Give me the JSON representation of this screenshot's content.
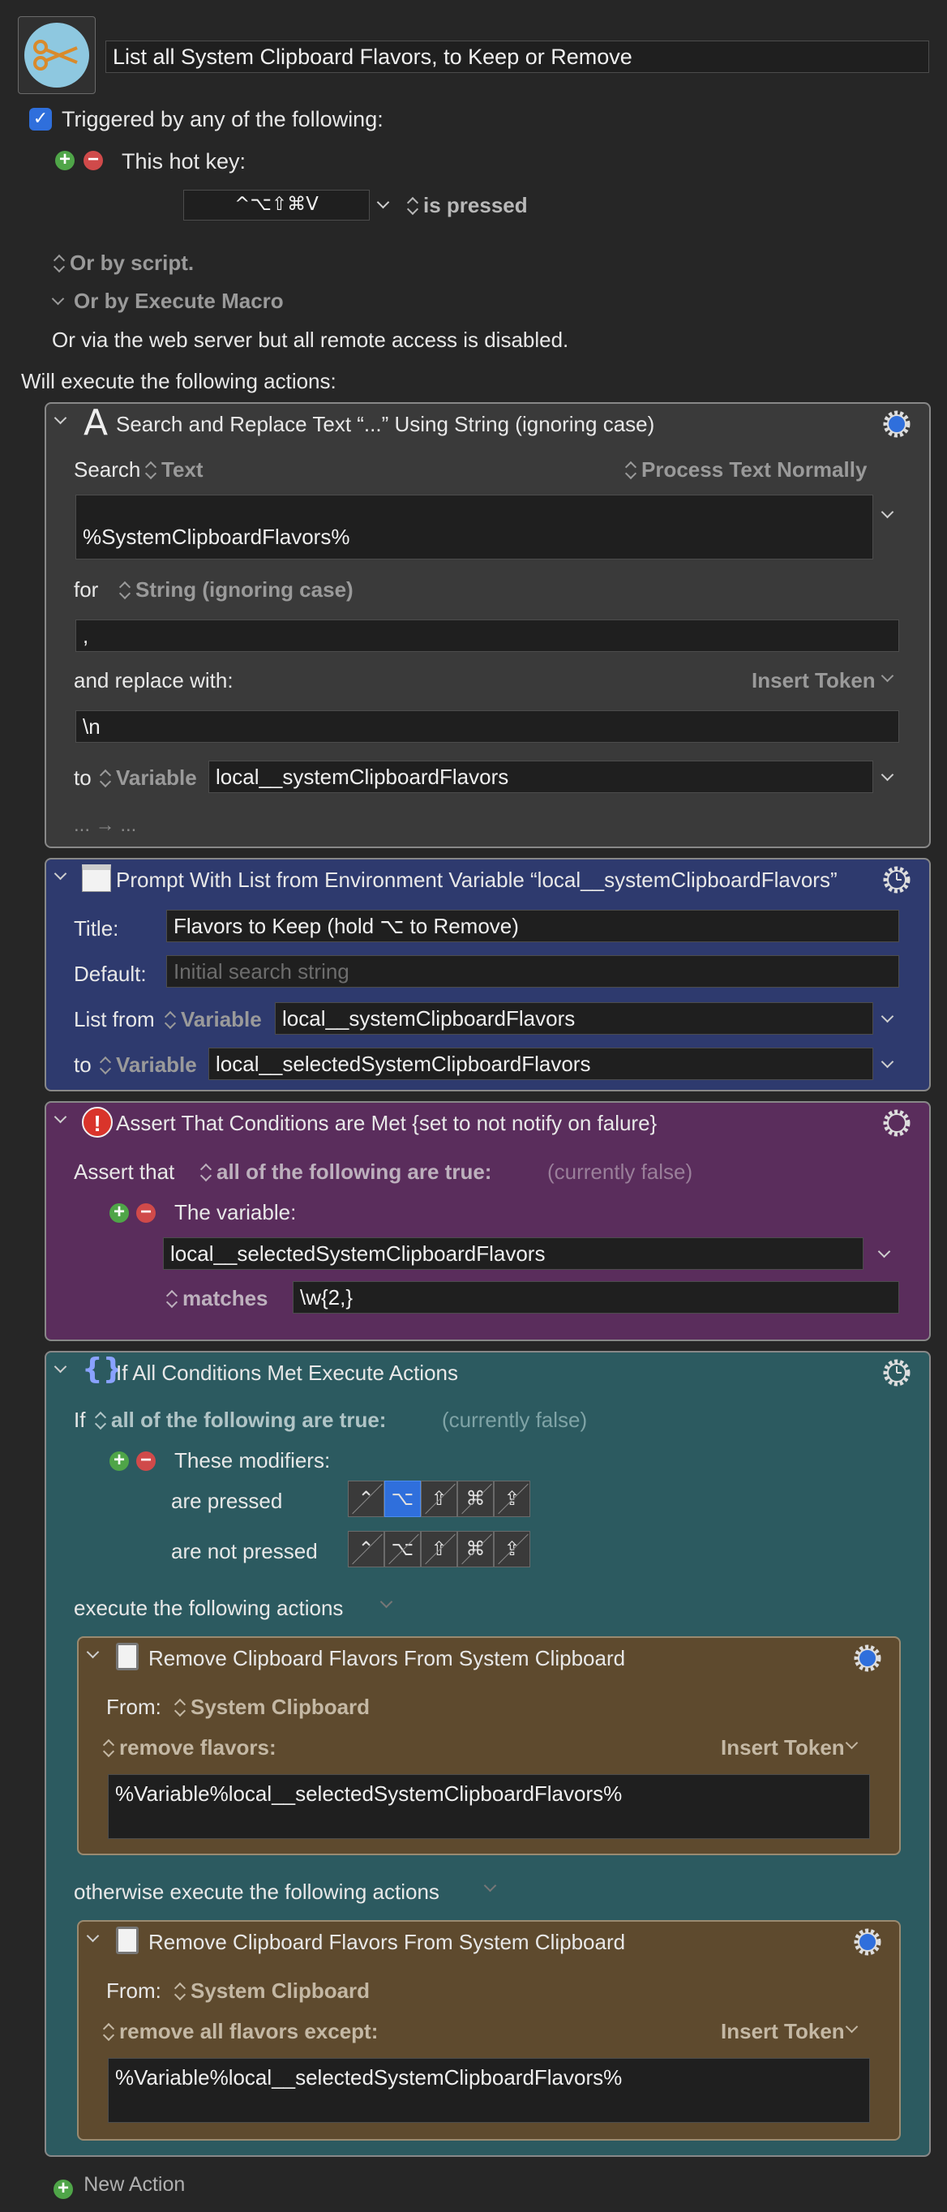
{
  "macro": {
    "name": "List all System Clipboard Flavors, to Keep or Remove",
    "trigger_label": "Triggered by any of the following:",
    "hotkey_label": "This hot key:",
    "hotkey": "^⌥⇧⌘V",
    "hotkey_state": "is pressed",
    "or_by_script": "Or by script.",
    "or_by_execute_macro": "Or by Execute Macro",
    "web_server_note": "Or via the web server but all remote access is disabled.",
    "will_execute": "Will execute the following actions:",
    "new_action": "New Action"
  },
  "action1": {
    "title": "Search and Replace Text “...” Using String (ignoring case)",
    "search_label": "Search",
    "search_source": "Text",
    "process_mode": "Process Text Normally",
    "search_text": "%SystemClipboardFlavors%",
    "for_label": "for",
    "for_mode": "String (ignoring case)",
    "for_value": ",",
    "replace_label": "and replace with:",
    "insert_token": "Insert Token",
    "replace_value": "\\n",
    "to_label": "to",
    "to_type": "Variable",
    "to_value": "local__systemClipboardFlavors",
    "footer": "... → ..."
  },
  "action2": {
    "title": "Prompt With List from Environment Variable “local__systemClipboardFlavors”",
    "title_label": "Title:",
    "title_value": "Flavors to Keep (hold ⌥ to Remove)",
    "default_label": "Default:",
    "default_placeholder": "Initial search string",
    "list_from_label": "List from",
    "list_from_type": "Variable",
    "list_from_value": "local__systemClipboardFlavors",
    "to_label": "to",
    "to_type": "Variable",
    "to_value": "local__selectedSystemClipboardFlavors"
  },
  "action3": {
    "title": "Assert That Conditions are Met {set to not notify on falure}",
    "assert_label": "Assert that",
    "assert_mode": "all of the following are true:",
    "status": "(currently false)",
    "condition_label": "The variable:",
    "variable": "local__selectedSystemClipboardFlavors",
    "match_mode": "matches",
    "match_value": "\\w{2,}"
  },
  "action4": {
    "title": "If All Conditions Met Execute Actions",
    "if_label": "If",
    "if_mode": "all of the following are true:",
    "status": "(currently false)",
    "condition_label": "These modifiers:",
    "pressed_label": "are pressed",
    "not_pressed_label": "are not pressed",
    "modifier_keys": [
      "⌃",
      "⌥",
      "⇧",
      "⌘",
      "⇪"
    ],
    "pressed_active": [
      false,
      true,
      false,
      false,
      false
    ],
    "execute_label": "execute the following actions",
    "otherwise_label": "otherwise execute the following actions"
  },
  "sub1": {
    "title": "Remove Clipboard Flavors From System Clipboard",
    "from_label": "From:",
    "from_value": "System Clipboard",
    "mode": "remove flavors:",
    "insert_token": "Insert Token",
    "value": "%Variable%local__selectedSystemClipboardFlavors%"
  },
  "sub2": {
    "title": "Remove Clipboard Flavors From System Clipboard",
    "from_label": "From:",
    "from_value": "System Clipboard",
    "mode": "remove all flavors except:",
    "insert_token": "Insert Token",
    "value": "%Variable%local__selectedSystemClipboardFlavors%"
  },
  "colors": {
    "background": "#262626",
    "action_gray": "#3a3a3a",
    "action_blue": "#2e3a6e",
    "action_purple": "#5a2d5c",
    "action_teal": "#2c5a60",
    "action_brown": "#5e4a2e",
    "accent_blue": "#2f6fdc"
  }
}
